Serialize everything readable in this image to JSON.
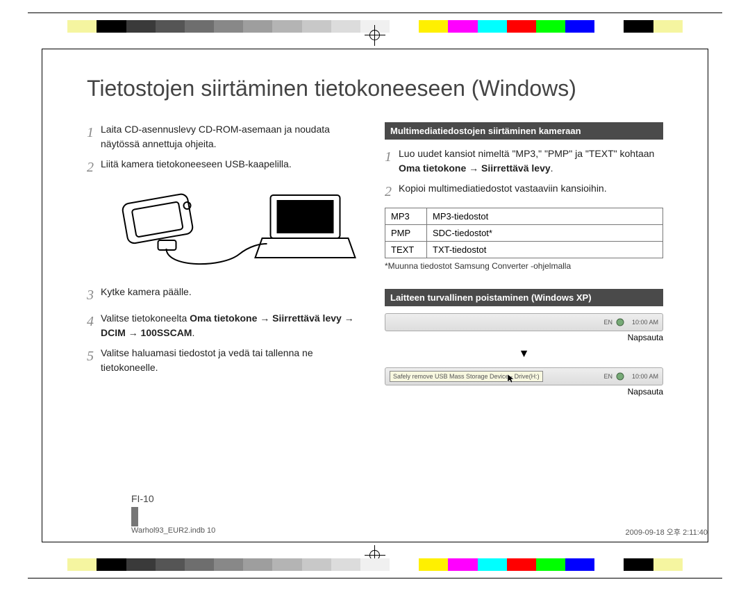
{
  "title": "Tietostojen siirtäminen tietokoneeseen (Windows)",
  "left": {
    "steps": [
      "Laita CD-asennuslevy CD-ROM-asemaan ja noudata näytössä annettuja ohjeita.",
      "Liitä kamera tietokoneeseen USB-kaapelilla.",
      "Kytke kamera päälle.",
      "Valitse tietokoneelta ",
      "Valitse haluamasi tiedostot ja vedä tai tallenna ne tietokoneelle."
    ],
    "step4_bold": "Oma tietokone → Siirrettävä levy → DCIM → 100SSCAM",
    "step4_suffix": "."
  },
  "right": {
    "heading1": "Multimediatiedostojen siirtäminen kameraan",
    "step1_a": "Luo uudet kansiot nimeltä \"MP3,\" \"PMP\" ja \"TEXT\" kohtaan ",
    "step1_b": "Oma tietokone → Siirrettävä levy",
    "step1_c": ".",
    "step2": "Kopioi multimediatiedostot vastaaviin kansioihin.",
    "table": [
      {
        "k": "MP3",
        "v": "MP3-tiedostot"
      },
      {
        "k": "PMP",
        "v": "SDC-tiedostot*"
      },
      {
        "k": "TEXT",
        "v": "TXT-tiedostot"
      }
    ],
    "footnote": "*Muunna tiedostot Samsung Converter -ohjelmalla",
    "heading2": "Laitteen turvallinen poistaminen (Windows XP)",
    "taskbar_time": "10:00 AM",
    "caption": "Napsauta",
    "popup": "Safely remove USB Mass Storage Device - Drive(H:)"
  },
  "page_number": "FI-10",
  "file_left": "Warhol93_EUR2.indb   10",
  "file_right": "2009-09-18   오후 2:11:40",
  "colorbar": [
    "#fff",
    "#f5f5a0",
    "#000",
    "#3a3a3a",
    "#555",
    "#6e6e6e",
    "#888",
    "#9e9e9e",
    "#b4b4b4",
    "#c8c8c8",
    "#dcdcdc",
    "#f0f0f0",
    "#fff",
    "#fff000",
    "#ff00ff",
    "#00ffff",
    "#ff0000",
    "#00ff00",
    "#0000ff",
    "#fff",
    "#000",
    "#f5f5a0",
    "#fff"
  ]
}
